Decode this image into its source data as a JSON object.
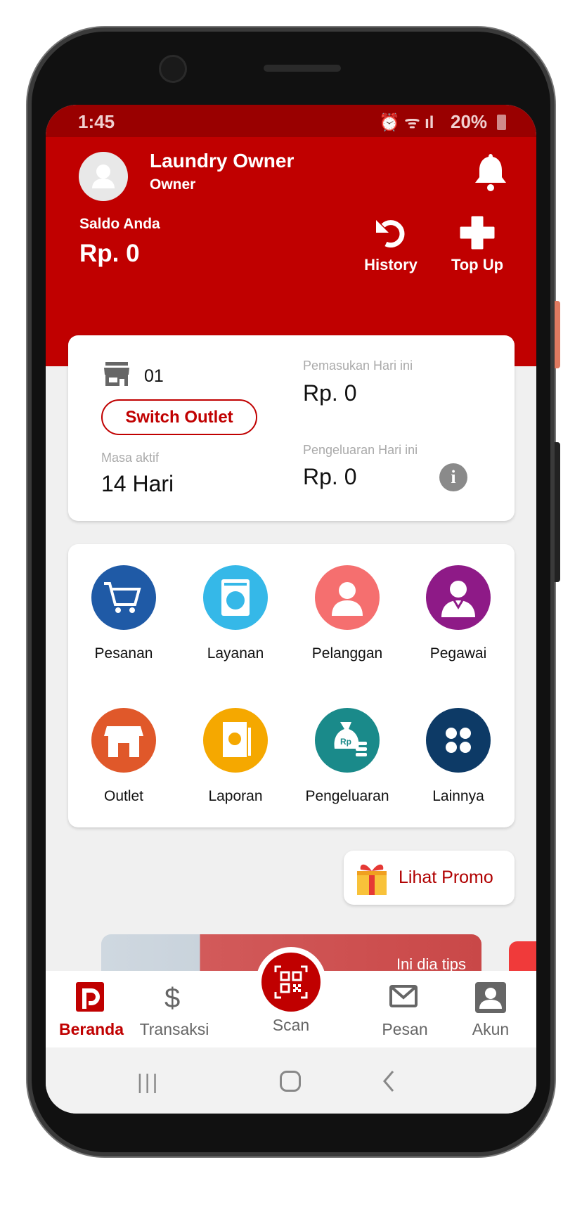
{
  "status_bar": {
    "time": "1:45",
    "battery": "20%"
  },
  "header": {
    "user_name": "Laundry Owner",
    "role": "Owner",
    "balance_label": "Saldo Anda",
    "balance_value": "Rp. 0",
    "history_label": "History",
    "topup_label": "Top Up"
  },
  "outlet_card": {
    "outlet_code": "01",
    "switch_label": "Switch Outlet",
    "active_label": "Masa aktif",
    "active_value": "14 Hari",
    "income_label": "Pemasukan Hari ini",
    "income_value": "Rp. 0",
    "expense_label": "Pengeluaran Hari ini",
    "expense_value": "Rp. 0"
  },
  "menu": [
    {
      "label": "Pesanan",
      "icon": "cart-icon",
      "color": "#1f5aa6"
    },
    {
      "label": "Layanan",
      "icon": "washing-machine-icon",
      "color": "#35b8e8"
    },
    {
      "label": "Pelanggan",
      "icon": "customer-icon",
      "color": "#f56f6f"
    },
    {
      "label": "Pegawai",
      "icon": "employee-icon",
      "color": "#8e1a87"
    },
    {
      "label": "Outlet",
      "icon": "store-icon",
      "color": "#e0582a"
    },
    {
      "label": "Laporan",
      "icon": "report-icon",
      "color": "#f5a800"
    },
    {
      "label": "Pengeluaran",
      "icon": "money-bag-icon",
      "color": "#1a8a8a"
    },
    {
      "label": "Lainnya",
      "icon": "more-icon",
      "color": "#0d3a66"
    }
  ],
  "promo": {
    "label": "Lihat Promo"
  },
  "banner": {
    "text": "Ini dia tips"
  },
  "bottom_nav": [
    {
      "label": "Beranda",
      "active": true
    },
    {
      "label": "Transaksi"
    },
    {
      "label": "Scan"
    },
    {
      "label": "Pesan"
    },
    {
      "label": "Akun"
    }
  ],
  "colors": {
    "primary": "#c00000",
    "status": "#990000"
  }
}
